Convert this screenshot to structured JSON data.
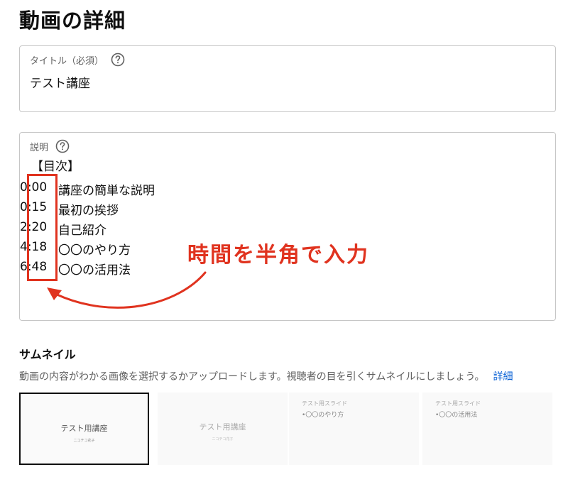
{
  "page": {
    "title": "動画の詳細"
  },
  "title_field": {
    "label": "タイトル（必須）",
    "value": "テスト講座"
  },
  "description_field": {
    "label": "説明",
    "heading": "【目次】",
    "rows": [
      {
        "time": "0:00",
        "text": "講座の簡単な説明"
      },
      {
        "time": "0:15",
        "text": "最初の挨拶"
      },
      {
        "time": "2:20",
        "text": "自己紹介"
      },
      {
        "time": "4:18",
        "text": "〇〇のやり方"
      },
      {
        "time": "6:48",
        "text": "〇〇の活用法"
      }
    ]
  },
  "annotation": {
    "text": "時間を半角で入力",
    "color": "#e0331f"
  },
  "thumbnail": {
    "heading": "サムネイル",
    "description": "動画の内容がわかる画像を選択するかアップロードします。視聴者の目を引くサムネイルにしましょう。",
    "details_link": "詳細",
    "options": [
      {
        "title": "テスト用講座",
        "subtitle": "ニコチコ花子"
      },
      {
        "title": "テスト用講座",
        "subtitle": "ニコチコ花子"
      },
      {
        "corner": "テスト用スライド",
        "bullet": "•〇〇のやり方"
      },
      {
        "corner": "テスト用スライド",
        "bullet": "•〇〇の活用法"
      }
    ]
  },
  "icons": {
    "help": "help-circle-icon",
    "arrow": "curved-arrow-icon"
  },
  "colors": {
    "accent_red": "#e0331f",
    "link_blue": "#065fd4",
    "border": "#c6c6c6"
  }
}
